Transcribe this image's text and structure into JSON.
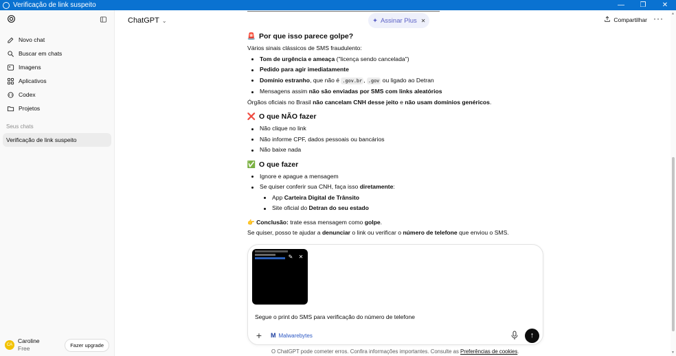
{
  "window": {
    "title": "Verificação de link suspeito",
    "controls": [
      "—",
      "❐",
      "✕"
    ]
  },
  "sidebar": {
    "items": [
      {
        "label": "Novo chat",
        "icon": "edit-icon"
      },
      {
        "label": "Buscar em chats",
        "icon": "search-icon"
      },
      {
        "label": "Imagens",
        "icon": "image-icon"
      },
      {
        "label": "Aplicativos",
        "icon": "apps-icon"
      },
      {
        "label": "Codex",
        "icon": "codex-icon"
      },
      {
        "label": "Projetos",
        "icon": "folder-icon"
      }
    ],
    "section_label": "Seus chats",
    "chats": [
      "Verificação de link suspeito"
    ],
    "user": {
      "initials": "CA",
      "name": "Caroline",
      "plan": "Free"
    },
    "upgrade_label": "Fazer upgrade"
  },
  "topbar": {
    "model": "ChatGPT",
    "plus_label": "Assinar Plus",
    "share_label": "Compartilhar",
    "more_label": "···"
  },
  "message": {
    "section1": {
      "emoji": "🚨",
      "title": "Por que isso parece golpe?",
      "intro": "Vários sinais clássicos de SMS fraudulento:",
      "b1_bold": "Tom de urgência e ameaça",
      "b1_rest": " (\"licença sendo cancelada\")",
      "b2_bold": "Pedido para agir imediatamente",
      "b3_bold": "Domínio estranho",
      "b3_mid": ", que não é ",
      "b3_code1": ".gov.br",
      "b3_comma": ", ",
      "b3_code2": ".gov",
      "b3_rest": " ou ligado ao Detran",
      "b4_pre": "Mensagens assim ",
      "b4_bold": "não são enviadas por SMS com links aleatórios",
      "p_pre": "Órgãos oficiais no Brasil ",
      "p_bold1": "não cancelam CNH desse jeito",
      "p_mid": " e ",
      "p_bold2": "não usam domínios genéricos",
      "p_end": "."
    },
    "section2": {
      "emoji": "❌",
      "title": "O que NÃO fazer",
      "items": [
        "Não clique no link",
        "Não informe CPF, dados pessoais ou bancários",
        "Não baixe nada"
      ]
    },
    "section3": {
      "emoji": "✅",
      "title": "O que fazer",
      "b1": "Ignore e apague a mensagem",
      "b2_pre": "Se quiser conferir sua CNH, faça isso ",
      "b2_bold": "diretamente",
      "b2_end": ":",
      "s1_pre": "App ",
      "s1_bold": "Carteira Digital de Trânsito",
      "s2_pre": "Site oficial do ",
      "s2_bold": "Detran do seu estado"
    },
    "conclusion": {
      "emoji": "👉",
      "bold": "Conclusão:",
      "mid": " trate essa mensagem como ",
      "bold2": "golpe",
      "end": "."
    },
    "offer": {
      "pre": "Se quiser, posso te ajudar a ",
      "bold1": "denunciar",
      "mid": " o link ou verificar o ",
      "bold2": "número de telefone",
      "end": " que enviou o SMS."
    }
  },
  "composer": {
    "prompt_text": "Segue o print do SMS para verificação do número de telefone",
    "tool_label": "Malwarebytes",
    "attachment_edit": "✎",
    "attachment_close": "✕",
    "send_symbol": "↑",
    "plus_symbol": "+"
  },
  "footer": {
    "disclaimer": "O ChatGPT pode cometer erros. Confira informações importantes. Consulte as ",
    "link": "Preferências de cookies",
    "end": "."
  }
}
